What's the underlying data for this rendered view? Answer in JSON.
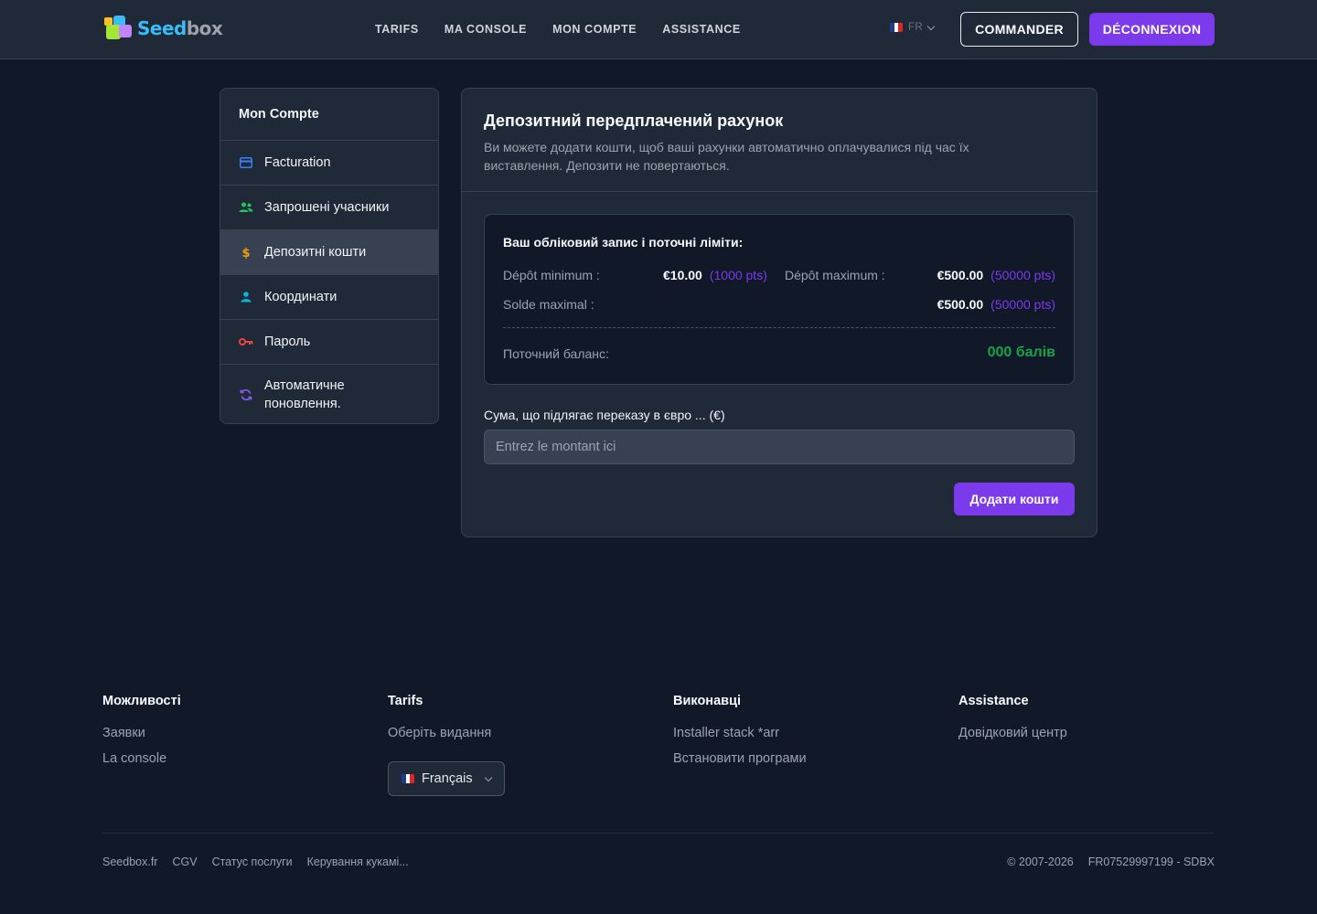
{
  "header": {
    "logo_text_a": "Seed",
    "logo_text_b": "box",
    "nav": [
      "TARIFS",
      "MA CONSOLE",
      "MON COMPTE",
      "ASSISTANCE"
    ],
    "lang_code": "FR",
    "commander_label": "COMMANDER",
    "logout_label": "DÉCONNEXION"
  },
  "sidebar": {
    "title": "Mon Compte",
    "items": [
      {
        "label": "Facturation",
        "icon": "credit-card-icon",
        "color": "#3b82f6"
      },
      {
        "label": "Запрошені учасники",
        "icon": "users-icon",
        "color": "#22c55e"
      },
      {
        "label": "Депозитні кошти",
        "icon": "dollar-icon",
        "color": "#f59e0b",
        "active": true
      },
      {
        "label": "Координати",
        "icon": "user-icon",
        "color": "#06b6d4"
      },
      {
        "label": "Пароль",
        "icon": "key-icon",
        "color": "#ef4444"
      },
      {
        "label": "Автоматичне поновлення.",
        "icon": "refresh-icon",
        "color": "#8b5cf6"
      }
    ]
  },
  "main": {
    "title": "Депозитний передплачений рахунок",
    "description": "Ви можете додати кошти, щоб ваші рахунки автоматично оплачувалися під час їх виставлення. Депозити не повертаються.",
    "limits": {
      "title": "Ваш обліковий запис і поточні ліміти:",
      "min_label": "Dépôt minimum :",
      "min_amount": "€10.00",
      "min_pts": "(1000 pts)",
      "max_label": "Dépôt maximum :",
      "max_amount": "€500.00",
      "max_pts": "(50000 pts)",
      "solde_label": "Solde maximal :",
      "solde_amount": "€500.00",
      "solde_pts": "(50000 pts)",
      "balance_label": "Поточний баланс:",
      "balance_value": "000 балів"
    },
    "amount_label": "Сума, що підлягає переказу в євро ... (€)",
    "amount_placeholder": "Entrez le montant ici",
    "add_button": "Додати кошти"
  },
  "footer": {
    "columns": [
      {
        "title": "Можливості",
        "links": [
          "Заявки",
          "La console"
        ]
      },
      {
        "title": "Tarifs",
        "links": [
          "Оберіть видання"
        ]
      },
      {
        "title": "Виконавці",
        "links": [
          "Installer stack *arr",
          "Встановити програми"
        ]
      },
      {
        "title": "Assistance",
        "links": [
          "Довідковий центр"
        ]
      }
    ],
    "language": "Français",
    "bottom_links": [
      "Seedbox.fr",
      "CGV",
      "Статус послуги",
      "Керування кукамі..."
    ],
    "copyright": "© 2007-2026",
    "company_id": "FR07529997199 - SDBX"
  },
  "colors": {
    "accent": "#7c3aed",
    "background": "#111827",
    "surface": "#1f2937",
    "success": "#16a34a"
  }
}
